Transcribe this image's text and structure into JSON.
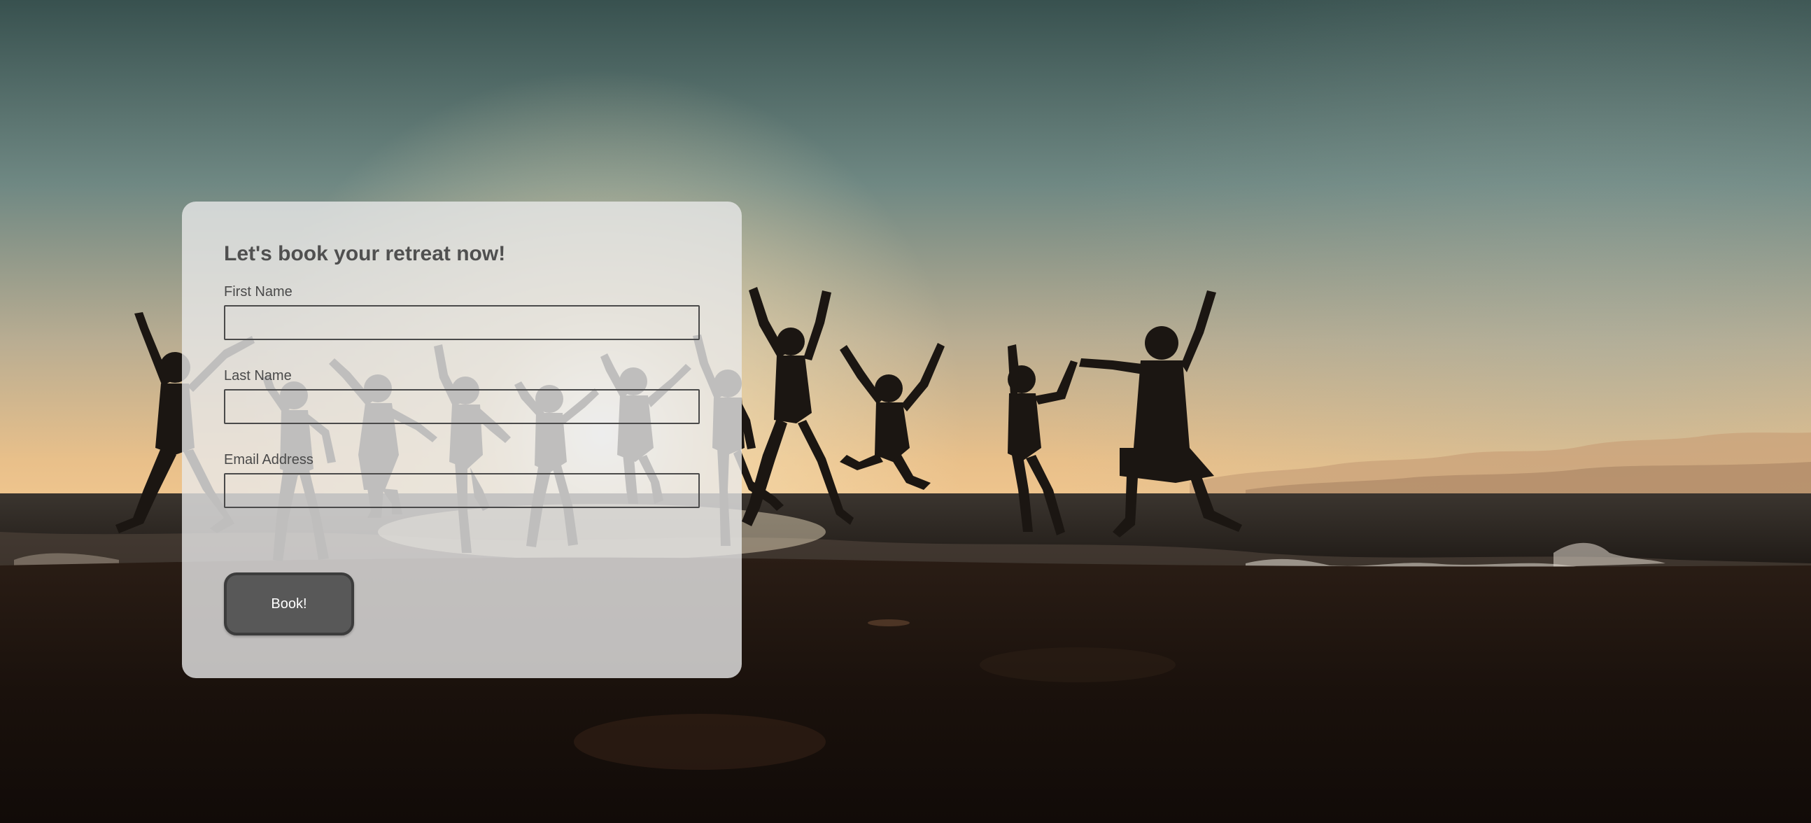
{
  "form": {
    "title": "Let's book your retreat now!",
    "fields": [
      {
        "label": "First Name",
        "value": "",
        "placeholder": ""
      },
      {
        "label": "Last Name",
        "value": "",
        "placeholder": ""
      },
      {
        "label": "Email Address",
        "value": "",
        "placeholder": ""
      }
    ],
    "submit_label": "Book!"
  },
  "background": {
    "description_icon": "beach-sunset-jumping-people-photo"
  },
  "colors": {
    "card_background": "#e8e8e8",
    "button_background": "#585858",
    "button_border": "#3c3c3c",
    "text": "#4a4a4a",
    "sky_top": "#3d5a5a",
    "sky_horizon": "#f2c98a",
    "sand": "#140d09"
  }
}
